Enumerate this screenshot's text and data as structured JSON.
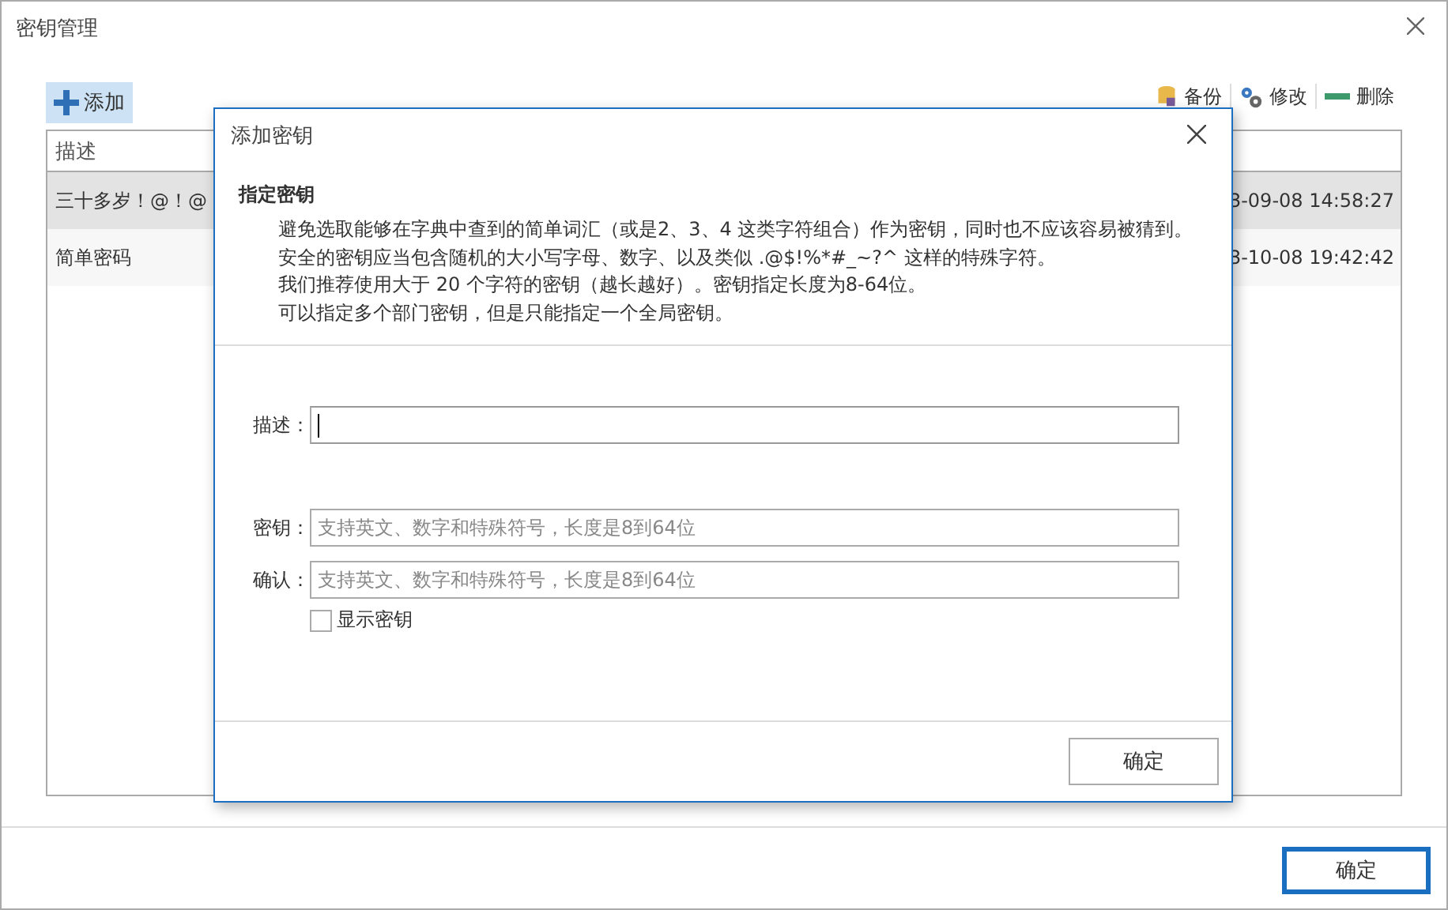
{
  "window": {
    "title": "密钥管理",
    "toolbar": {
      "add": "添加",
      "actions": [
        {
          "kind": "backup",
          "label": "备份"
        },
        {
          "kind": "edit",
          "label": "修改"
        },
        {
          "kind": "delete",
          "label": "删除"
        }
      ]
    },
    "table": {
      "columns": [
        "描述"
      ],
      "rows": [
        {
          "description": "三十多岁！@！@",
          "time": "3-09-08 14:58:27",
          "selected": true
        },
        {
          "description": "简单密码",
          "time": "3-10-08 19:42:42",
          "selected": false
        }
      ]
    },
    "confirm_button": "确定"
  },
  "dialog": {
    "title": "添加密钥",
    "heading": "指定密钥",
    "paragraphs": [
      "避免选取能够在字典中查到的简单词汇（或是2、3、4 这类字符组合）作为密钥，同时也不应该容易被猜到。",
      "安全的密钥应当包含随机的大小写字母、数字、以及类似 .@$!%*#_~?^ 这样的特殊字符。",
      "我们推荐使用大于 20 个字符的密钥（越长越好）。密钥指定长度为8-64位。",
      "可以指定多个部门密钥，但是只能指定一个全局密钥。"
    ],
    "fields": [
      {
        "label": "描述：",
        "focused": true
      },
      {
        "label": "密钥：",
        "placeholder": "支持英文、数字和特殊符号，长度是8到64位",
        "focused": false
      },
      {
        "label": "确认：",
        "placeholder": "支持英文、数字和特殊符号，长度是8到64位",
        "focused": false
      }
    ],
    "show_key": {
      "label": "显示密钥",
      "checked": false
    },
    "confirm_button": "确定"
  }
}
